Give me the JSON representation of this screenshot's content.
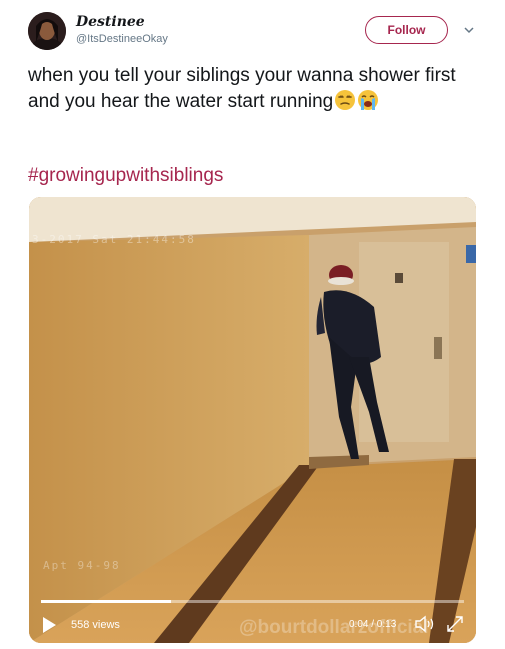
{
  "tweet": {
    "display_name": "Destinee",
    "handle": "@ItsDestineeOkay",
    "follow_label": "Follow",
    "text": "when you tell your siblings your wanna shower first and you hear the water start running",
    "emojis": [
      "unamused-face",
      "loudly-crying-face"
    ],
    "hashtag": "#growingupwithsiblings"
  },
  "video": {
    "views": "558 views",
    "time": "0:04 / 0:13",
    "progress_fraction": 0.3077,
    "watermark": "@bourtdollarzofficial",
    "cam_timestamp_top": "3-2017 Sat 21:44:58",
    "cam_timestamp_bottom": "Apt 94-98"
  },
  "colors": {
    "accent": "#a6264e",
    "text": "#14171a",
    "muted": "#657786"
  }
}
